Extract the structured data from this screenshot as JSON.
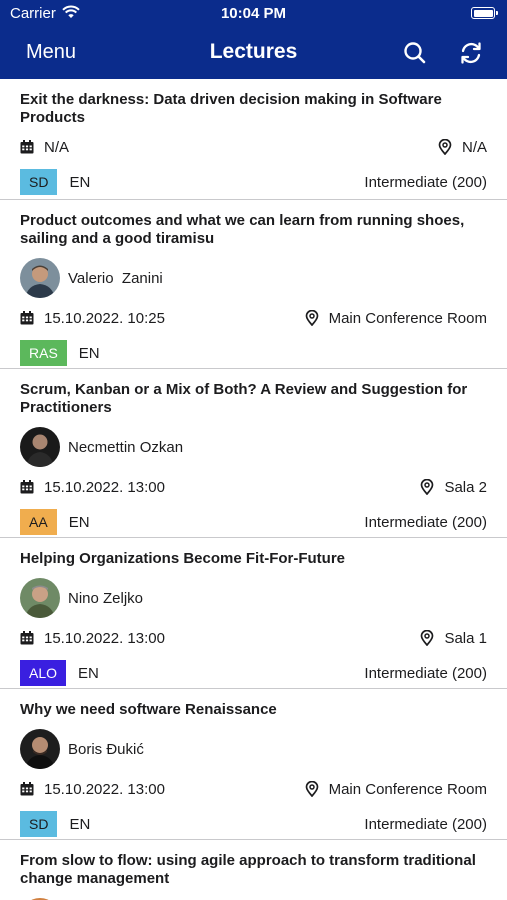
{
  "status_bar": {
    "carrier": "Carrier",
    "time": "10:04 PM"
  },
  "nav": {
    "menu_label": "Menu",
    "title": "Lectures"
  },
  "colors": {
    "header": "#0b2c8c",
    "SD": "#5bbbe0",
    "RAS": "#5cb85c",
    "AA": "#f0ad4e",
    "ALO": "#3a1fe0"
  },
  "lectures": [
    {
      "title": "Exit the darkness: Data driven decision making in Software Products",
      "speaker": "",
      "datetime": "N/A",
      "location": "N/A",
      "track": "SD",
      "language": "EN",
      "level": "Intermediate (200)"
    },
    {
      "title": "Product outcomes and what we can learn from running shoes, sailing and a good tiramisu",
      "speaker": "Valerio  Zanini",
      "datetime": "15.10.2022. 10:25",
      "location": "Main Conference Room",
      "track": "RAS",
      "language": "EN",
      "level": ""
    },
    {
      "title": "Scrum, Kanban or a Mix of Both? A Review and Suggestion for Practitioners",
      "speaker": "Necmettin Ozkan",
      "datetime": "15.10.2022. 13:00",
      "location": "Sala 2",
      "track": "AA",
      "language": "EN",
      "level": "Intermediate (200)"
    },
    {
      "title": "Helping Organizations Become Fit-For-Future",
      "speaker": "Nino Zeljko",
      "datetime": "15.10.2022. 13:00",
      "location": "Sala 1",
      "track": "ALO",
      "language": "EN",
      "level": "Intermediate (200)"
    },
    {
      "title": "Why we need software Renaissance",
      "speaker": "Boris Đukić",
      "datetime": "15.10.2022. 13:00",
      "location": "Main Conference Room",
      "track": "SD",
      "language": "EN",
      "level": "Intermediate (200)"
    },
    {
      "title": "From slow to flow: using agile approach to transform traditional change management",
      "speaker": "",
      "datetime": "",
      "location": "",
      "track": "",
      "language": "",
      "level": ""
    }
  ]
}
